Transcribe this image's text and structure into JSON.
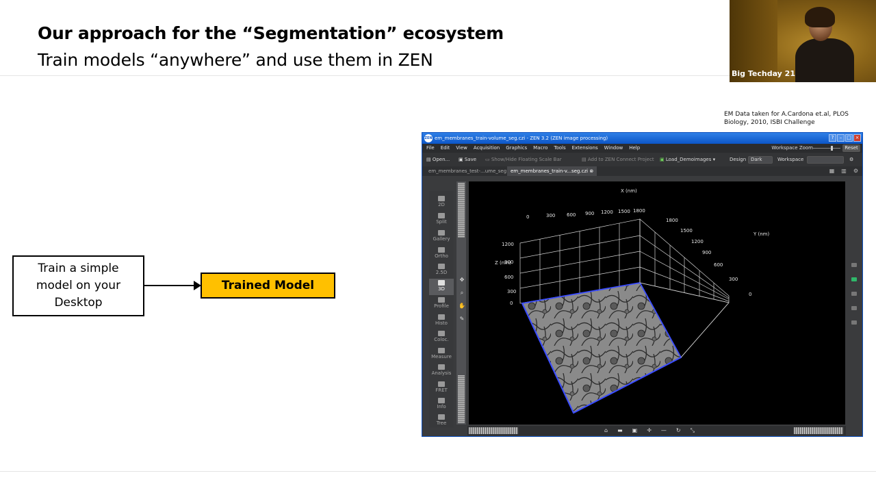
{
  "slide": {
    "title": "Our approach for the “Segmentation” ecosystem",
    "subtitle": "Train models “anywhere” and use them in ZEN",
    "credit_line1": "EM Data taken for A.Cardona et.al, PLOS",
    "credit_line2": "Biology, 2010, ISBI Challenge"
  },
  "webcam": {
    "caption": "Big Techday 21"
  },
  "flow": {
    "train_box": "Train a simple model on your Desktop",
    "model_box": "Trained Model"
  },
  "zen": {
    "window_title": "em_membranes_train-volume_seg.czi - ZEN 3.2 (ZEN image processing)",
    "logo": "ZEN",
    "menu": [
      "File",
      "Edit",
      "View",
      "Acquisition",
      "Graphics",
      "Macro",
      "Tools",
      "Extensions",
      "Window",
      "Help"
    ],
    "workspace_zoom_label": "Workspace Zoom",
    "reset_label": "Reset",
    "toolbar": {
      "open": "Open...",
      "save": "Save",
      "scale_bar": "Show/Hide Floating Scale Bar",
      "connect": "Add to ZEN Connect Project",
      "demo": "Load_Demoimages",
      "design_label": "Design",
      "design_value": "Dark",
      "workspace_label": "Workspace"
    },
    "tabs": [
      {
        "label": "em_membranes_test-...ume_seg"
      },
      {
        "label": "em_membranes_train-v...seg.czi"
      }
    ],
    "views": [
      "2D",
      "Split",
      "Gallery",
      "Ortho",
      "2.5D",
      "3D",
      "Profile",
      "Histo",
      "Coloc.",
      "Measure",
      "Analysis",
      "FRET",
      "Info",
      "Tree"
    ],
    "active_view": "3D",
    "axes": {
      "x_title": "X (nm)",
      "y_title": "Y (nm)",
      "z_title": "Z (nm)",
      "x_ticks": [
        "0",
        "300",
        "600",
        "900",
        "1200",
        "1500",
        "1800"
      ],
      "y_ticks": [
        "1800",
        "1500",
        "1200",
        "900",
        "600",
        "300",
        "0"
      ],
      "z_ticks": [
        "1200",
        "900",
        "600",
        "300",
        "0"
      ]
    },
    "colors": {
      "titlebar": "#1565d8",
      "accent_yellow": "#ffc000",
      "volume_edge": "#3a4cff"
    }
  }
}
